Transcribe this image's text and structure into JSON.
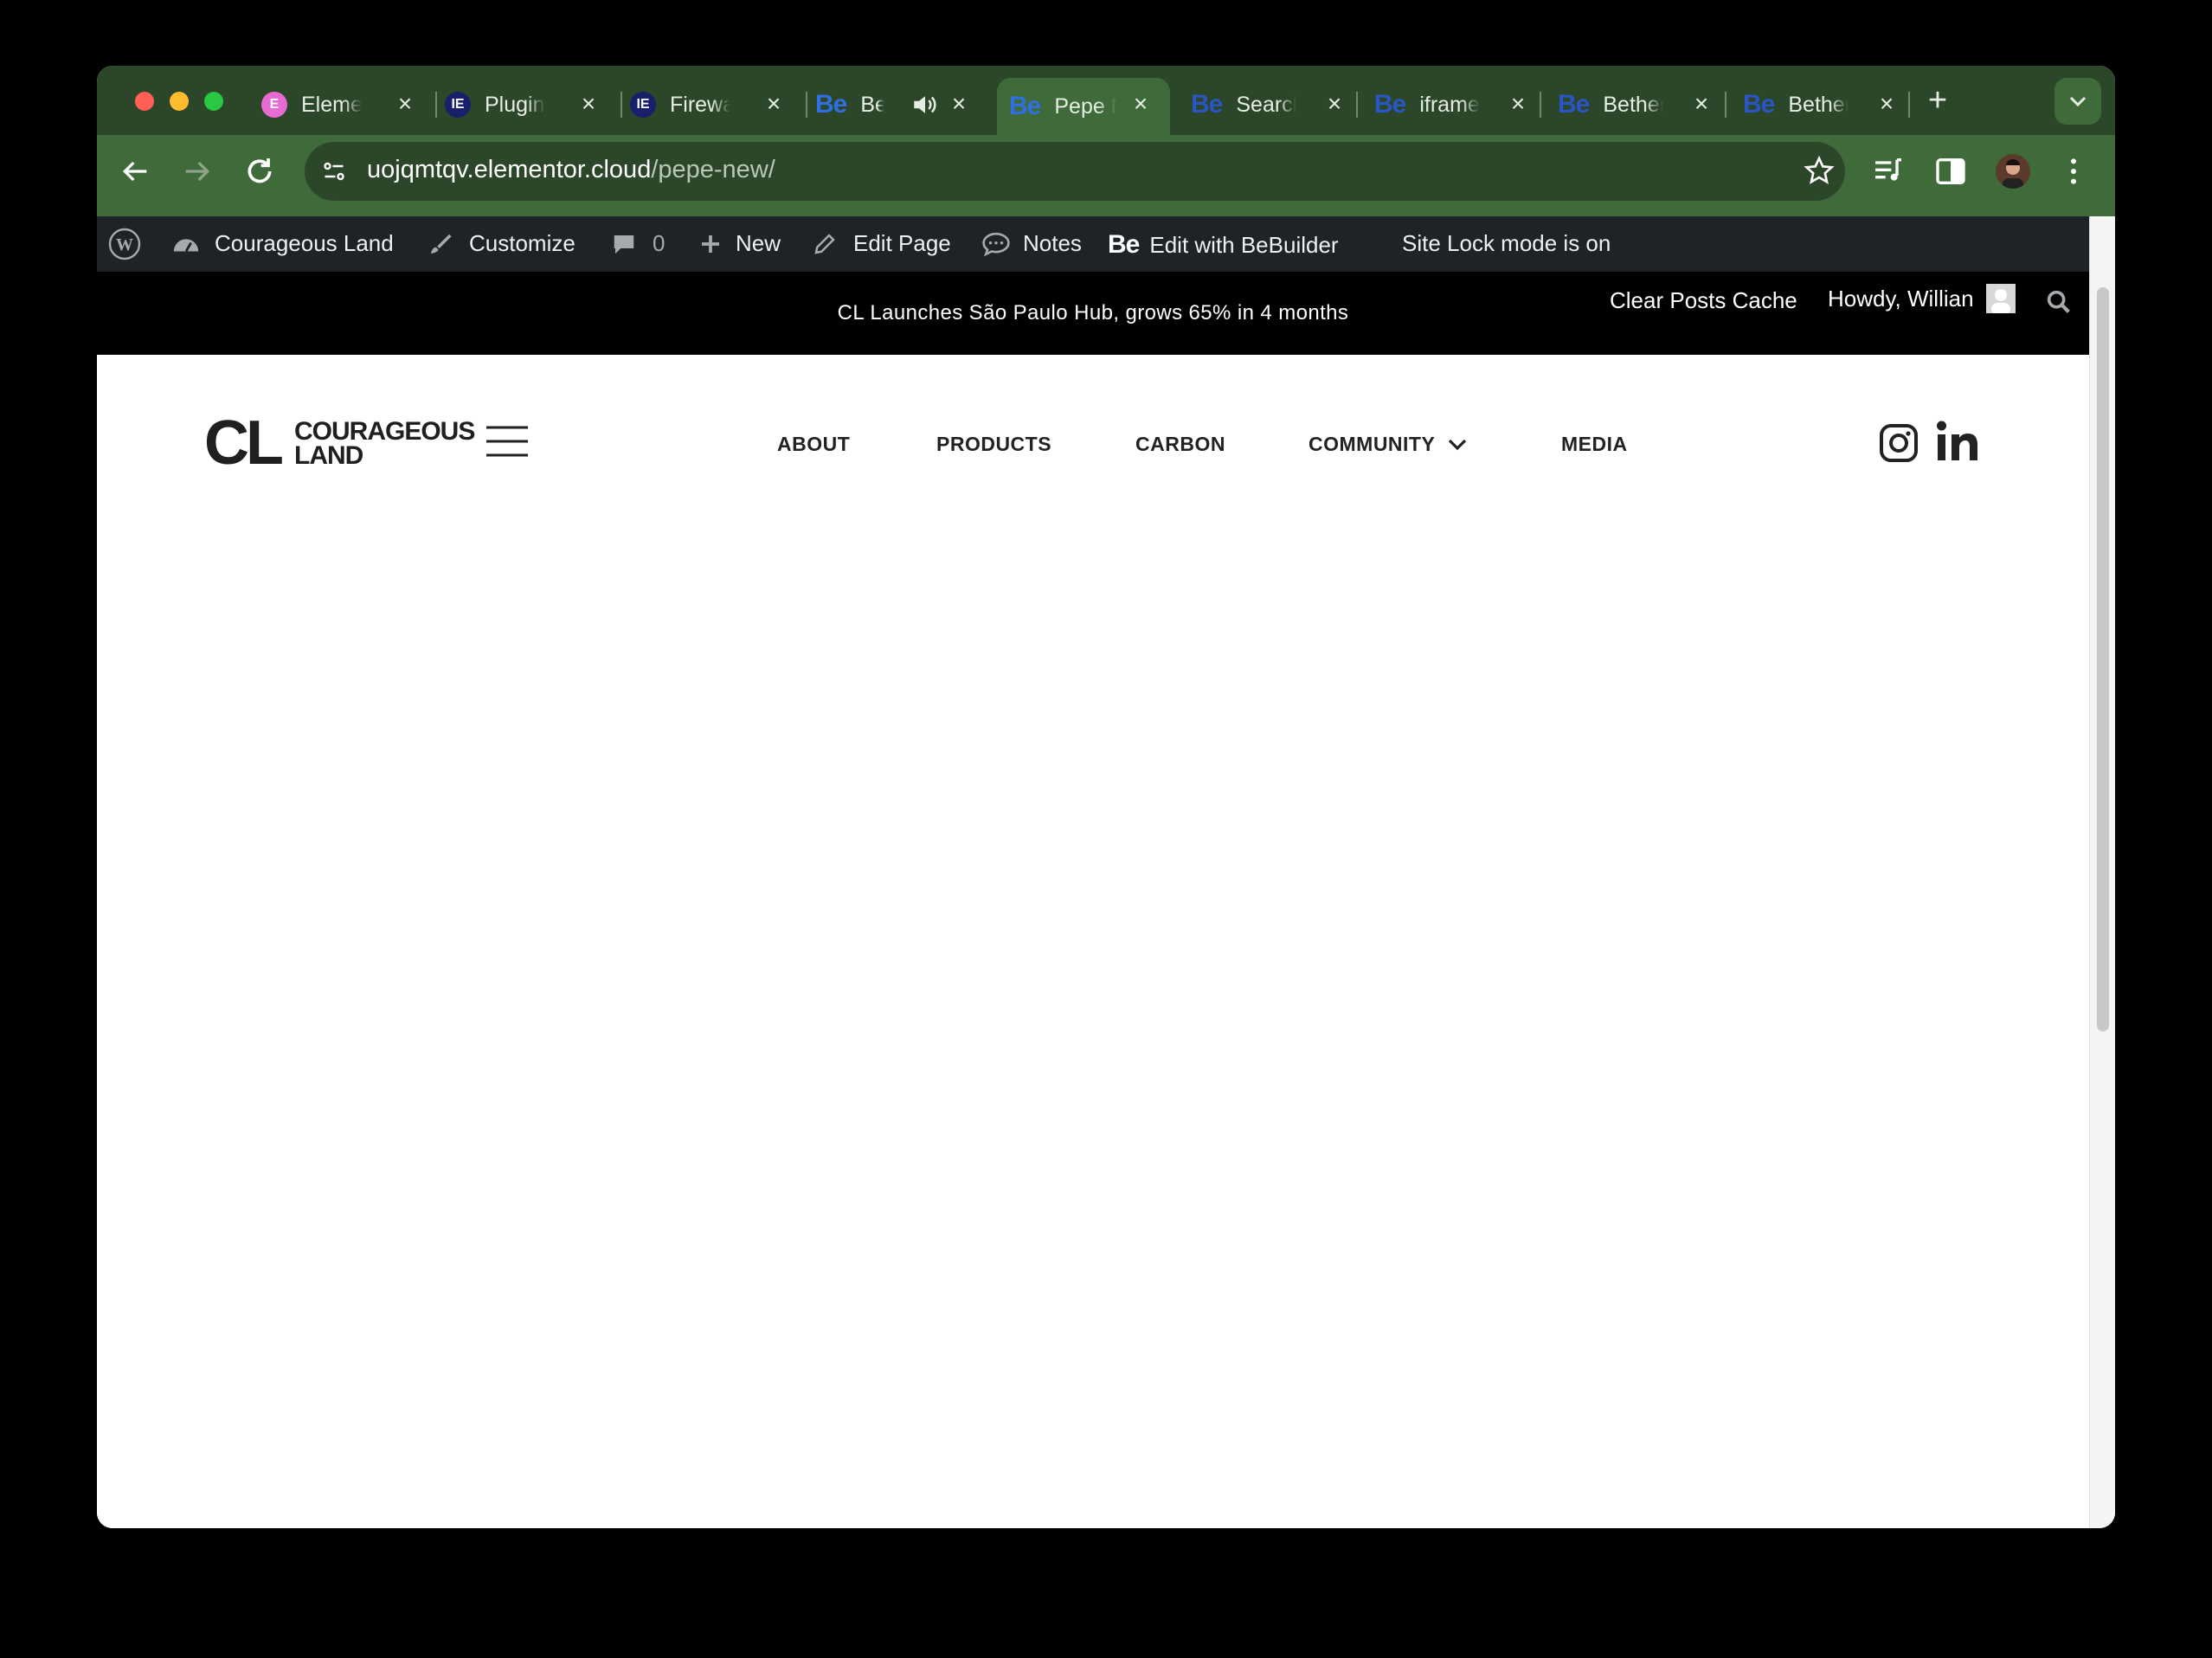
{
  "browser": {
    "tabs": [
      {
        "title": "Elementor",
        "favicon": "elementor-icon",
        "active": false
      },
      {
        "title": "Plugins",
        "favicon": "elementor-icon",
        "active": false
      },
      {
        "title": "Firewall",
        "favicon": "elementor-icon",
        "active": false
      },
      {
        "title": "BeBuilder",
        "favicon": "be-icon",
        "active": false,
        "audio": true
      },
      {
        "title": "Pepe New",
        "favicon": "be-icon",
        "active": true
      },
      {
        "title": "Search",
        "favicon": "be-icon",
        "active": false
      },
      {
        "title": "iframe",
        "favicon": "be-icon",
        "active": false
      },
      {
        "title": "Betheme",
        "favicon": "be-icon",
        "active": false
      },
      {
        "title": "Betheme",
        "favicon": "be-icon",
        "active": false
      }
    ],
    "fav_badge_be": "Be",
    "fav_badge_el": "E",
    "fav_badge_el2": "IE",
    "url_host": "uojqmtqv.elementor.cloud",
    "url_path": "/pepe-new/"
  },
  "admin_bar": {
    "site_name": "Courageous Land",
    "customize": "Customize",
    "comments_count": "0",
    "new": "New",
    "edit_page": "Edit Page",
    "notes": "Notes",
    "be_badge": "Be",
    "edit_with": "Edit with BeBuilder",
    "site_lock": "Site Lock mode is on",
    "clear_cache": "Clear Posts Cache",
    "howdy": "Howdy, Willian"
  },
  "announcement": "CL Launches São Paulo Hub, grows 65% in 4 months",
  "site": {
    "logo_mark": "CL",
    "logo_line1": "COURAGEOUS",
    "logo_line2": "LAND",
    "nav": [
      "ABOUT",
      "PRODUCTS",
      "CARBON",
      "COMMUNITY",
      "MEDIA"
    ]
  },
  "colors": {
    "tab_strip": "#2b4629",
    "toolbar": "#3f6b3a",
    "admin_bar": "#1d2327",
    "announcement_bar": "#000000",
    "be_blue": "#2f6fe0"
  }
}
